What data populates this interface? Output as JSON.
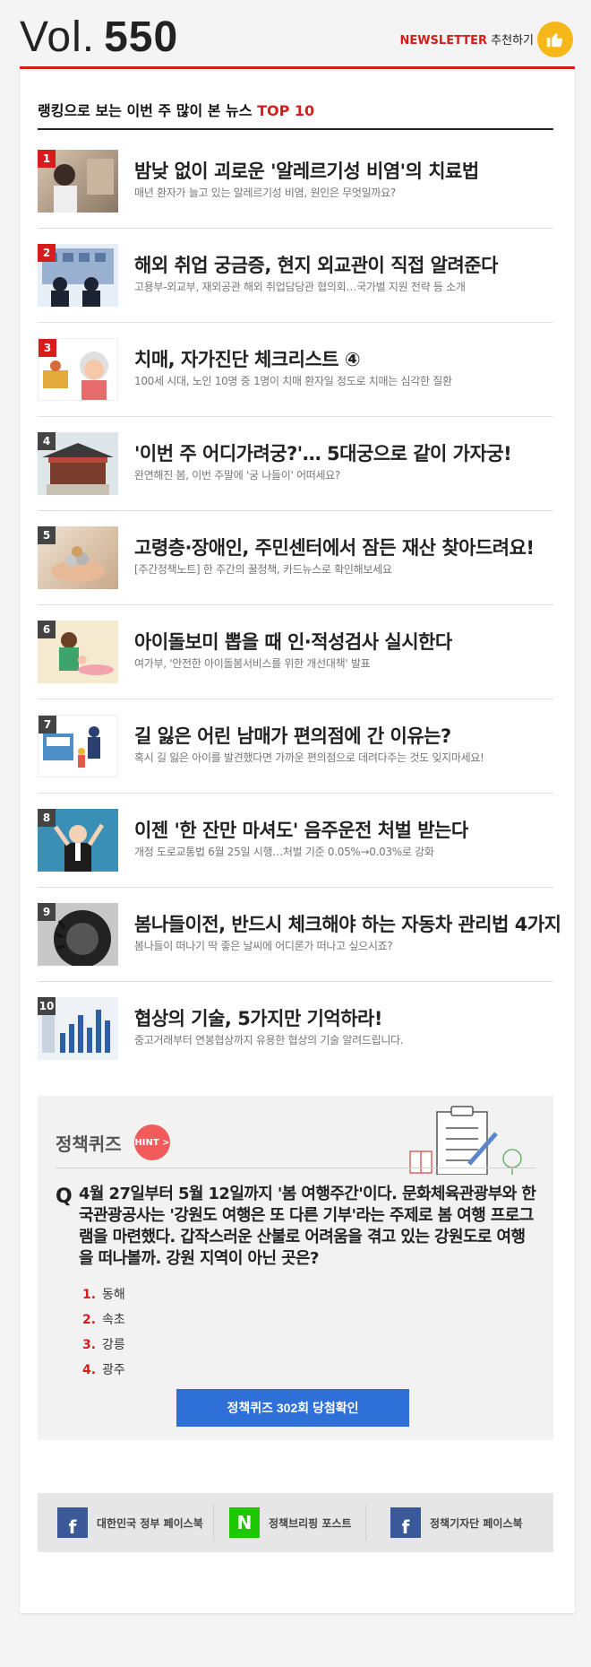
{
  "header": {
    "vol_label": "Vol.",
    "vol_number": "550",
    "newsletter_red": "NEWSLETTER",
    "newsletter_text": "추천하기",
    "thumb_icon": "thumbs-up-icon"
  },
  "top10": {
    "title_prefix": "랭킹으로 보는 이번 주 많이 본 뉴스",
    "title_highlight": "TOP 10",
    "items": [
      {
        "rank": "1",
        "title": "밤낮 없이 괴로운 '알레르기성 비염'의 치료법",
        "subtitle": "매년 환자가 늘고 있는 알레르기성 비염, 원인은 무엇일까요?"
      },
      {
        "rank": "2",
        "title": "해외 취업 궁금증, 현지 외교관이 직접 알려준다",
        "subtitle": "고용부-외교부, 재외공관 해외 취업담당관 협의회…국가별 지원 전략 등 소개"
      },
      {
        "rank": "3",
        "title": "치매, 자가진단 체크리스트 ④",
        "subtitle": "100세 시대, 노인 10명 중 1명이 치매 환자일 정도로 치매는 심각한 질환"
      },
      {
        "rank": "4",
        "title": "'이번 주 어디가려궁?'… 5대궁으로 같이 가자궁!",
        "subtitle": "완연해진 봄, 이번 주말에 '궁 나들이' 어떠세요?"
      },
      {
        "rank": "5",
        "title": "고령층·장애인, 주민센터에서 잠든 재산 찾아드려요!",
        "subtitle": "[주간정책노트] 한 주간의 꿀정책, 카드뉴스로 확인해보세요"
      },
      {
        "rank": "6",
        "title": "아이돌보미 뽑을 때 인·적성검사 실시한다",
        "subtitle": "여가부, '안전한 아이돌봄서비스를 위한 개선대책' 발표"
      },
      {
        "rank": "7",
        "title": "길 잃은 어린 남매가 편의점에 간 이유는?",
        "subtitle": "혹시 길 잃은 아이를 발견했다면 가까운 편의점으로 데려다주는 것도 잊지마세요!"
      },
      {
        "rank": "8",
        "title": "이젠 '한 잔만 마셔도' 음주운전 처벌 받는다",
        "subtitle": "개정 도로교통법 6월 25일 시행…처벌 기준 0.05%→0.03%로 강화"
      },
      {
        "rank": "9",
        "title": "봄나들이전, 반드시 체크해야 하는 자동차 관리법 4가지",
        "subtitle": "봄나들이 떠나기 딱 좋은 날씨에 어디론가 떠나고 싶으시죠?"
      },
      {
        "rank": "10",
        "title": "협상의 기술, 5가지만 기억하라!",
        "subtitle": "중고거래부터 연봉협상까지 유용한 협상의 기술 알려드립니다."
      }
    ]
  },
  "quiz": {
    "title": "정책퀴즈",
    "hint": "HINT >",
    "q_mark": "Q",
    "question": "4월 27일부터 5월 12일까지 '봄 여행주간'이다. 문화체육관광부와 한국관광공사는 '강원도 여행은 또 다른 기부'라는 주제로 봄 여행 프로그램을 마련했다. 갑작스러운 산불로 어려움을 겪고 있는 강원도로 여행을 떠나볼까. 강원 지역이 아닌 곳은?",
    "options": [
      {
        "num": "1.",
        "text": "동해"
      },
      {
        "num": "2.",
        "text": "속초"
      },
      {
        "num": "3.",
        "text": "강릉"
      },
      {
        "num": "4.",
        "text": "광주"
      }
    ],
    "button": "정책퀴즈 302회 당첨확인"
  },
  "footer": {
    "links": [
      {
        "icon": "facebook-icon",
        "glyph": "f",
        "color": "#3b5998",
        "label": "대한민국 정부 페이스북"
      },
      {
        "icon": "naver-post-icon",
        "glyph": "N",
        "color": "#1ec800",
        "label": "정책브리핑 포스트"
      },
      {
        "icon": "facebook-icon",
        "glyph": "f",
        "color": "#3b5998",
        "label": "정책기자단 페이스북"
      }
    ]
  },
  "colors": {
    "accent_red": "#d81c1c",
    "button_blue": "#2f6fd8",
    "hint_red": "#f15b5b",
    "thumb_yellow": "#f6b719"
  }
}
